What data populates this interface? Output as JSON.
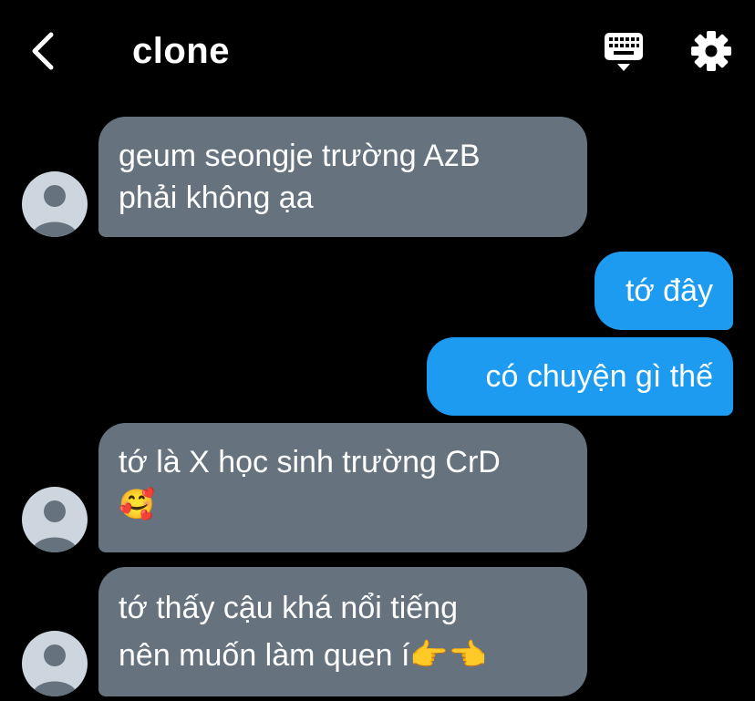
{
  "header": {
    "title": "clone",
    "back_icon": "chevron-left-icon",
    "keyboard_icon": "keyboard-icon",
    "settings_icon": "gear-icon"
  },
  "colors": {
    "background": "#000000",
    "incoming_bubble": "#66737f",
    "outgoing_bubble": "#1d9bf0",
    "avatar_bg": "#cdd6de",
    "avatar_fg": "#66737f"
  },
  "messages": [
    {
      "direction": "in",
      "lines": [
        "geum seongje trường AzB",
        "phải không ạa"
      ]
    },
    {
      "direction": "out",
      "lines": [
        "tớ đây"
      ]
    },
    {
      "direction": "out",
      "lines": [
        "có chuyện gì thế"
      ]
    },
    {
      "direction": "in",
      "lines": [
        "tớ là X học sinh trường CrD",
        "🥰"
      ]
    },
    {
      "direction": "in",
      "lines": [
        "tớ thấy cậu khá nổi tiếng",
        "nên muốn làm quen í👉👈"
      ]
    }
  ]
}
